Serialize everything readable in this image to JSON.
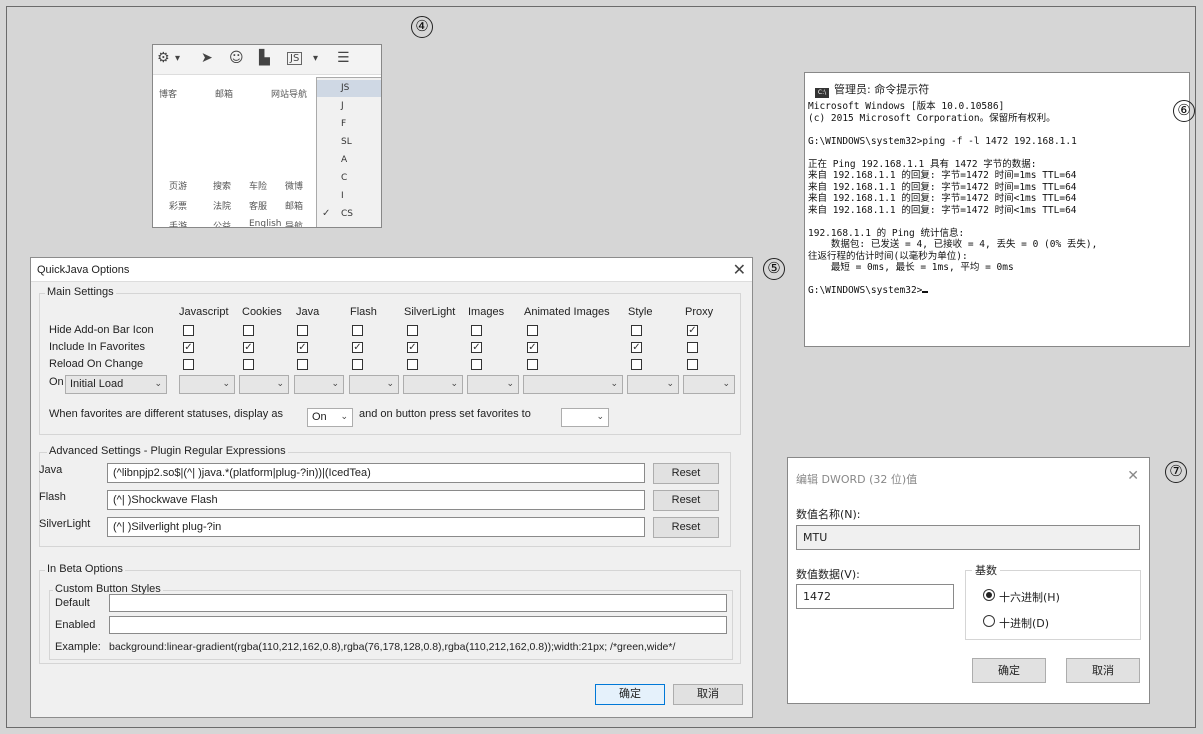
{
  "markers": {
    "p4": "④",
    "p5": "⑤",
    "p6": "⑥",
    "p7": "⑦"
  },
  "browser": {
    "toolbar_icons": [
      "gear-menu-icon",
      "dropdown-arrow-icon",
      "send-icon",
      "face-icon",
      "block-icon",
      "js-icon",
      "hamburger-menu-icon"
    ],
    "nav_links": [
      "博客",
      "邮箱",
      "网站导航"
    ],
    "grid_links": [
      [
        "页游",
        "搜索",
        "车险",
        "微博"
      ],
      [
        "彩票",
        "法院",
        "客服",
        "邮箱"
      ],
      [
        "手游",
        "公益",
        "English",
        "导航"
      ]
    ],
    "menu_items": [
      "JS",
      "J",
      "F",
      "SL",
      "A",
      "C",
      "I",
      "CS"
    ],
    "menu_checked": "CS"
  },
  "quickjava": {
    "title": "QuickJava Options",
    "main_settings_label": "Main Settings",
    "columns": [
      "Javascript",
      "Cookies",
      "Java",
      "Flash",
      "SilverLight",
      "Images",
      "Animated Images",
      "Style",
      "Proxy"
    ],
    "rows": [
      {
        "label": "Hide Add-on Bar Icon",
        "checks": [
          false,
          false,
          false,
          false,
          false,
          false,
          false,
          false,
          true
        ]
      },
      {
        "label": "Include In Favorites",
        "checks": [
          true,
          true,
          true,
          true,
          true,
          true,
          true,
          true,
          false
        ]
      },
      {
        "label": "Reload On Change",
        "checks": [
          false,
          false,
          false,
          false,
          false,
          false,
          false,
          false,
          false
        ]
      }
    ],
    "on_label": "On",
    "on_select": "Initial Load",
    "favorites_text": "When favorites are different statuses, display as",
    "favorites_value": "On",
    "favorites_text2": "and on button press set favorites to",
    "advanced_label": "Advanced Settings - Plugin Regular Expressions",
    "plugins": [
      {
        "name": "Java",
        "regex": "(^libnpjp2.so$|(^| )java.*(platform|plug-?in))|(IcedTea)",
        "button": "Reset"
      },
      {
        "name": "Flash",
        "regex": "(^| )Shockwave Flash",
        "button": "Reset"
      },
      {
        "name": "SilverLight",
        "regex": "(^| )Silverlight plug-?in",
        "button": "Reset"
      }
    ],
    "beta_label": "In Beta Options",
    "custom_styles_label": "Custom Button Styles",
    "default_label": "Default",
    "enabled_label": "Enabled",
    "example_label": "Example:",
    "example_text": "background:linear-gradient(rgba(110,212,162,0.8),rgba(76,178,128,0.8),rgba(110,212,162,0.8));width:21px; /*green,wide*/",
    "ok": "确定",
    "cancel": "取消"
  },
  "cmd": {
    "title": "管理员: 命令提示符",
    "icon_text": "C:\\",
    "lines": [
      "Microsoft Windows [版本 10.0.10586]",
      "(c) 2015 Microsoft Corporation。保留所有权利。",
      "",
      "G:\\WINDOWS\\system32>ping -f -l 1472 192.168.1.1",
      "",
      "正在 Ping 192.168.1.1 具有 1472 字节的数据:",
      "来自 192.168.1.1 的回复: 字节=1472 时间=1ms TTL=64",
      "来自 192.168.1.1 的回复: 字节=1472 时间=1ms TTL=64",
      "来自 192.168.1.1 的回复: 字节=1472 时间<1ms TTL=64",
      "来自 192.168.1.1 的回复: 字节=1472 时间<1ms TTL=64",
      "",
      "192.168.1.1 的 Ping 统计信息:",
      "    数据包: 已发送 = 4, 已接收 = 4, 丢失 = 0 (0% 丢失),",
      "往返行程的估计时间(以毫秒为单位):",
      "    最短 = 0ms, 最长 = 1ms, 平均 = 0ms",
      "",
      "G:\\WINDOWS\\system32>"
    ]
  },
  "dword": {
    "title": "编辑 DWORD (32 位)值",
    "name_label": "数值名称(N):",
    "name_value": "MTU",
    "data_label": "数值数据(V):",
    "data_value": "1472",
    "base_label": "基数",
    "hex_label": "十六进制(H)",
    "dec_label": "十进制(D)",
    "ok": "确定",
    "cancel": "取消"
  }
}
